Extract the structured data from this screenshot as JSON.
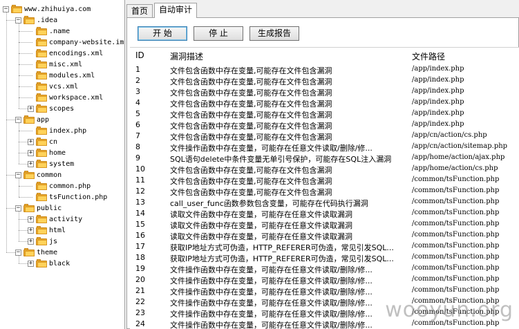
{
  "tree": [
    {
      "label": "www.zhihuiya.com",
      "level": 0,
      "toggle": "−"
    },
    {
      "label": ".idea",
      "level": 1,
      "toggle": "−"
    },
    {
      "label": ".name",
      "level": 2,
      "toggle": ""
    },
    {
      "label": "company-website.iml",
      "level": 2,
      "toggle": ""
    },
    {
      "label": "encodings.xml",
      "level": 2,
      "toggle": ""
    },
    {
      "label": "misc.xml",
      "level": 2,
      "toggle": ""
    },
    {
      "label": "modules.xml",
      "level": 2,
      "toggle": ""
    },
    {
      "label": "vcs.xml",
      "level": 2,
      "toggle": ""
    },
    {
      "label": "workspace.xml",
      "level": 2,
      "toggle": ""
    },
    {
      "label": "scopes",
      "level": 2,
      "toggle": "+"
    },
    {
      "label": "app",
      "level": 1,
      "toggle": "−"
    },
    {
      "label": "index.php",
      "level": 2,
      "toggle": ""
    },
    {
      "label": "cn",
      "level": 2,
      "toggle": "+"
    },
    {
      "label": "home",
      "level": 2,
      "toggle": "+"
    },
    {
      "label": "system",
      "level": 2,
      "toggle": "+"
    },
    {
      "label": "common",
      "level": 1,
      "toggle": "−"
    },
    {
      "label": "common.php",
      "level": 2,
      "toggle": ""
    },
    {
      "label": "tsFunction.php",
      "level": 2,
      "toggle": ""
    },
    {
      "label": "public",
      "level": 1,
      "toggle": "−"
    },
    {
      "label": "activity",
      "level": 2,
      "toggle": "+"
    },
    {
      "label": "html",
      "level": 2,
      "toggle": "+"
    },
    {
      "label": "js",
      "level": 2,
      "toggle": "+"
    },
    {
      "label": "theme",
      "level": 1,
      "toggle": "−"
    },
    {
      "label": "black",
      "level": 2,
      "toggle": "+"
    }
  ],
  "tabs": [
    {
      "label": "首页",
      "active": false
    },
    {
      "label": "自动审计",
      "active": true
    }
  ],
  "buttons": {
    "start": "开 始",
    "stop": "停 止",
    "report": "生成报告"
  },
  "columns": {
    "id": "ID",
    "desc": "漏洞描述",
    "path": "文件路径"
  },
  "rows": [
    {
      "id": "1",
      "desc": "文件包含函数中存在变量,可能存在文件包含漏洞",
      "path": "/app/index.php"
    },
    {
      "id": "2",
      "desc": "文件包含函数中存在变量,可能存在文件包含漏洞",
      "path": "/app/index.php"
    },
    {
      "id": "3",
      "desc": "文件包含函数中存在变量,可能存在文件包含漏洞",
      "path": "/app/index.php"
    },
    {
      "id": "4",
      "desc": "文件包含函数中存在变量,可能存在文件包含漏洞",
      "path": "/app/index.php"
    },
    {
      "id": "5",
      "desc": "文件包含函数中存在变量,可能存在文件包含漏洞",
      "path": "/app/index.php"
    },
    {
      "id": "6",
      "desc": "文件包含函数中存在变量,可能存在文件包含漏洞",
      "path": "/app/index.php"
    },
    {
      "id": "7",
      "desc": "文件包含函数中存在变量,可能存在文件包含漏洞",
      "path": "/app/cn/action/cs.php"
    },
    {
      "id": "8",
      "desc": "文件操作函数中存在变量，可能存在任意文件读取/删除/修...",
      "path": "/app/cn/action/sitemap.php"
    },
    {
      "id": "9",
      "desc": "SQL语句delete中条件变量无单引号保护，可能存在SQL注入漏洞",
      "path": "/app/home/action/ajax.php"
    },
    {
      "id": "10",
      "desc": "文件包含函数中存在变量,可能存在文件包含漏洞",
      "path": "/app/home/action/cs.php"
    },
    {
      "id": "11",
      "desc": "文件包含函数中存在变量,可能存在文件包含漏洞",
      "path": "/common/tsFunction.php"
    },
    {
      "id": "12",
      "desc": "文件包含函数中存在变量,可能存在文件包含漏洞",
      "path": "/common/tsFunction.php"
    },
    {
      "id": "13",
      "desc": "call_user_func函数参数包含变量，可能存在代码执行漏洞",
      "path": "/common/tsFunction.php"
    },
    {
      "id": "14",
      "desc": "读取文件函数中存在变量，可能存在任意文件读取漏洞",
      "path": "/common/tsFunction.php"
    },
    {
      "id": "15",
      "desc": "读取文件函数中存在变量，可能存在任意文件读取漏洞",
      "path": "/common/tsFunction.php"
    },
    {
      "id": "16",
      "desc": "读取文件函数中存在变量，可能存在任意文件读取漏洞",
      "path": "/common/tsFunction.php"
    },
    {
      "id": "17",
      "desc": "获取IP地址方式可伪造，HTTP_REFERER可伪造，常见引发SQL...",
      "path": "/common/tsFunction.php"
    },
    {
      "id": "18",
      "desc": "获取IP地址方式可伪造，HTTP_REFERER可伪造，常见引发SQL...",
      "path": "/common/tsFunction.php"
    },
    {
      "id": "19",
      "desc": "文件操作函数中存在变量，可能存在任意文件读取/删除/修...",
      "path": "/common/tsFunction.php"
    },
    {
      "id": "20",
      "desc": "文件操作函数中存在变量，可能存在任意文件读取/删除/修...",
      "path": "/common/tsFunction.php"
    },
    {
      "id": "21",
      "desc": "文件操作函数中存在变量，可能存在任意文件读取/删除/修...",
      "path": "/common/tsFunction.php"
    },
    {
      "id": "22",
      "desc": "文件操作函数中存在变量，可能存在任意文件读取/删除/修...",
      "path": "/common/tsFunction.php"
    },
    {
      "id": "23",
      "desc": "文件操作函数中存在变量，可能存在任意文件读取/删除/修...",
      "path": "/common/tsFunction.php"
    },
    {
      "id": "24",
      "desc": "文件操作函数中存在变量，可能存在任意文件读取/删除/修...",
      "path": "/common/tsFunction.php"
    }
  ],
  "watermark": "wooyun.org"
}
